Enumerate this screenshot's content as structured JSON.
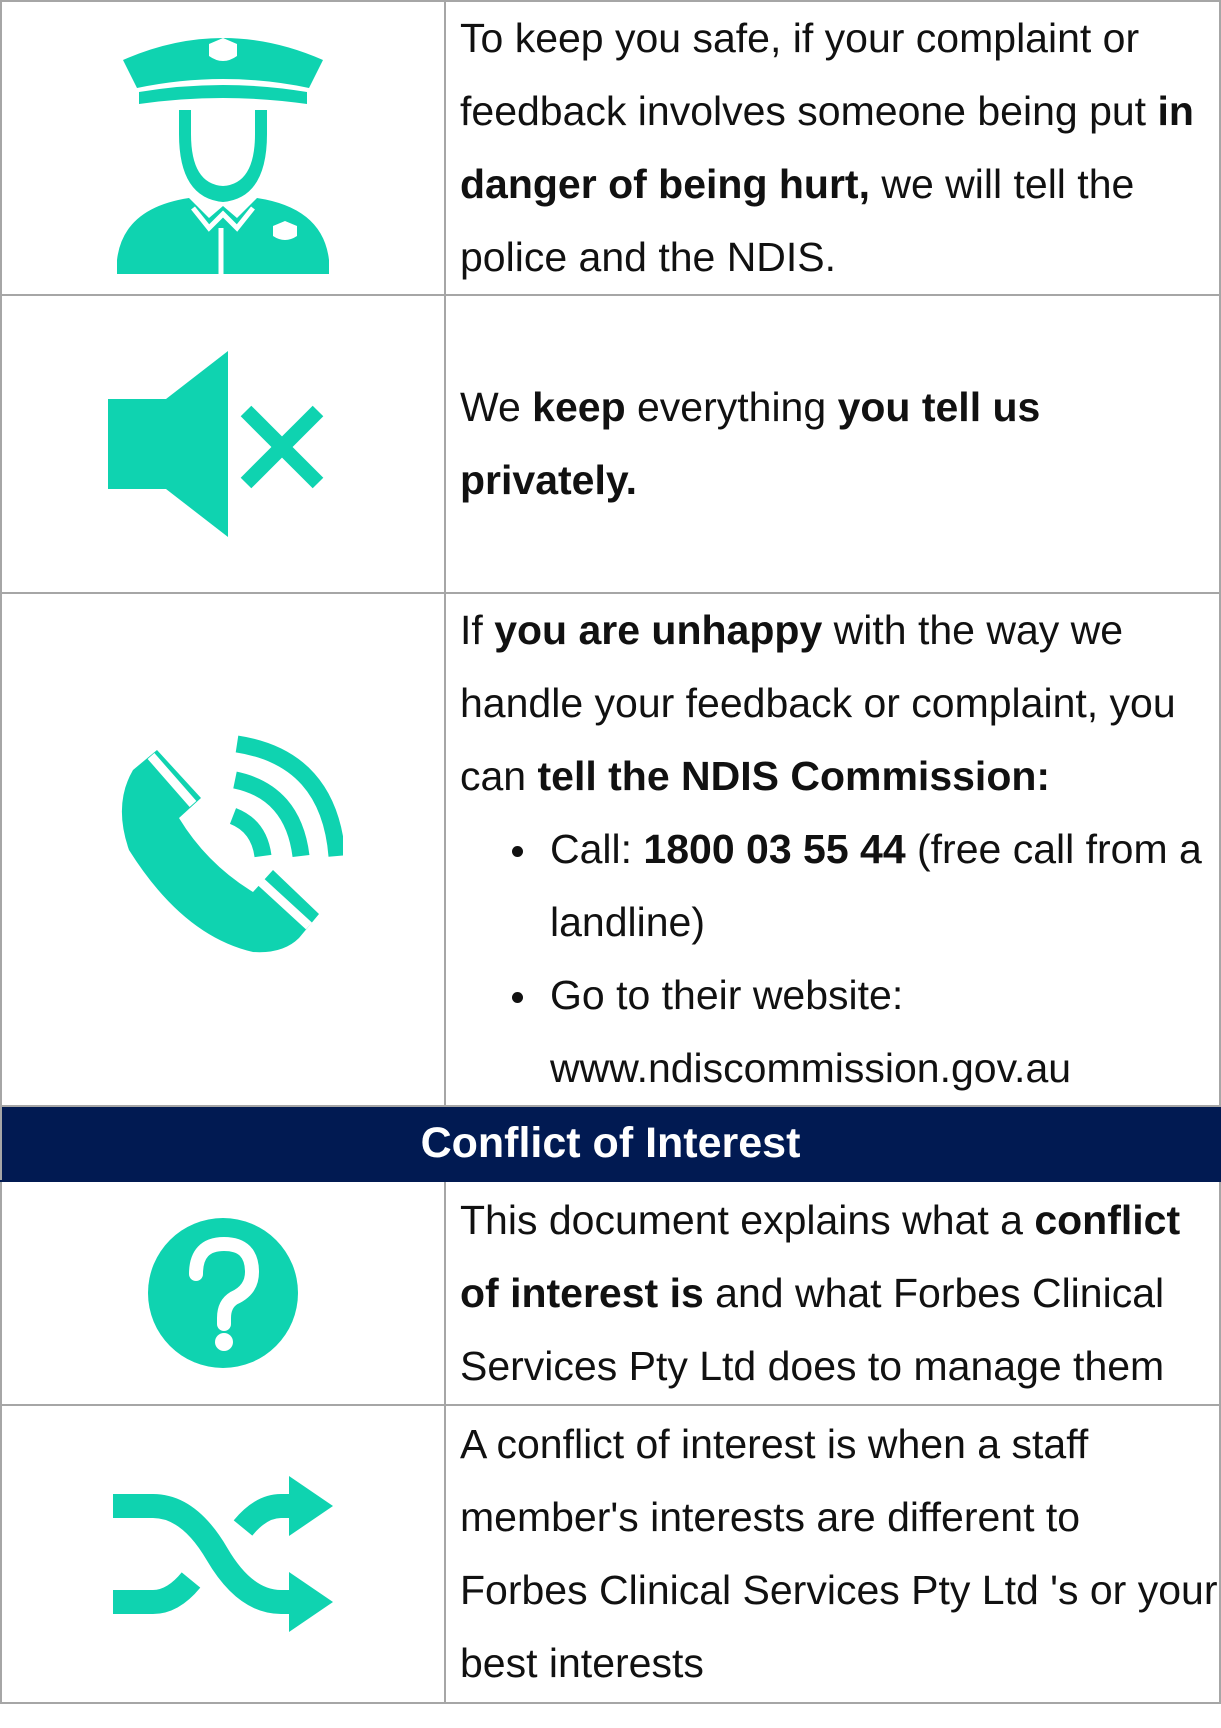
{
  "colors": {
    "accent": "#0fd3b0",
    "header_bg": "#011a52",
    "border": "#a6a6a6"
  },
  "rows": [
    {
      "icon": "police-officer-icon",
      "text": {
        "a": "To keep you safe, if your complaint or feedback involves someone being put ",
        "b": "in danger of being hurt,",
        "c": " we will tell the police and the NDIS."
      }
    },
    {
      "icon": "speaker-muted-icon",
      "text": {
        "a": "We ",
        "b": "keep",
        "c": " everything ",
        "d": "you tell us privately."
      }
    },
    {
      "icon": "phone-ringing-icon",
      "text": {
        "a": "If ",
        "b": "you are unhappy",
        "c": " with the way we handle your feedback or complaint, you can ",
        "d": "tell the NDIS Commission:"
      },
      "bullets": [
        {
          "a": "Call: ",
          "b": "1800 03 55 44",
          "c": " (free call from a landline)"
        },
        {
          "a": "Go to their website: www.ndiscommission.gov.au"
        }
      ]
    }
  ],
  "section_header": "Conflict of Interest",
  "rows2": [
    {
      "icon": "question-mark-icon",
      "text": {
        "a": "This document explains what a ",
        "b": "conflict of interest is",
        "c": " and what Forbes Clinical Services Pty Ltd does to manage them"
      }
    },
    {
      "icon": "shuffle-arrows-icon",
      "text": {
        "a": "A conflict of interest is when a staff member's interests are different to Forbes Clinical Services Pty Ltd 's or your best interests"
      }
    }
  ]
}
